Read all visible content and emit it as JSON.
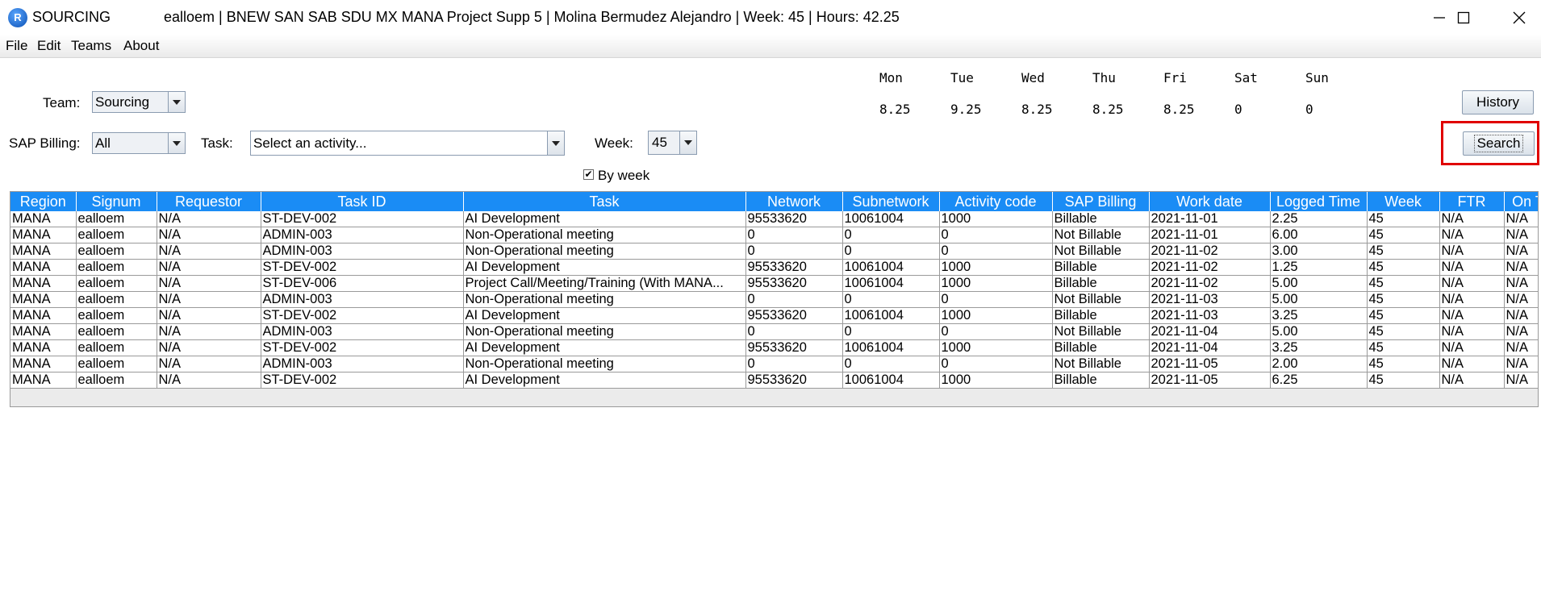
{
  "window": {
    "app_name": "SOURCING",
    "title": "ealloem | BNEW SAN SAB SDU MX MANA Project Supp 5 | Molina Bermudez Alejandro | Week: 45 | Hours: 42.25"
  },
  "menu": [
    "File",
    "Edit",
    "Teams",
    "About"
  ],
  "form": {
    "team_label": "Team:",
    "team_value": "Sourcing",
    "sap_label": "SAP Billing:",
    "sap_value": "All",
    "task_label": "Task:",
    "task_value": "Select an activity...",
    "week_label": "Week:",
    "week_value": "45",
    "by_week_label": "By week",
    "by_week_checked": true,
    "history_button": "History",
    "search_button": "Search"
  },
  "days": [
    {
      "name": "Mon",
      "hours": "8.25"
    },
    {
      "name": "Tue",
      "hours": "9.25"
    },
    {
      "name": "Wed",
      "hours": "8.25"
    },
    {
      "name": "Thu",
      "hours": "8.25"
    },
    {
      "name": "Fri",
      "hours": "8.25"
    },
    {
      "name": "Sat",
      "hours": "0"
    },
    {
      "name": "Sun",
      "hours": "0"
    }
  ],
  "table": {
    "columns": [
      "Region",
      "Signum",
      "Requestor",
      "Task ID",
      "Task",
      "Network",
      "Subnetwork",
      "Activity code",
      "SAP Billing",
      "Work date",
      "Logged Time",
      "Week",
      "FTR",
      "On T"
    ],
    "rows": [
      [
        "MANA",
        "ealloem",
        "N/A",
        "ST-DEV-002",
        "AI Development",
        "95533620",
        "10061004",
        "1000",
        "Billable",
        "2021-11-01",
        "2.25",
        "45",
        "N/A",
        "N/A"
      ],
      [
        "MANA",
        "ealloem",
        "N/A",
        "ADMIN-003",
        "Non-Operational meeting",
        "0",
        "0",
        "0",
        "Not Billable",
        "2021-11-01",
        "6.00",
        "45",
        "N/A",
        "N/A"
      ],
      [
        "MANA",
        "ealloem",
        "N/A",
        "ADMIN-003",
        "Non-Operational meeting",
        "0",
        "0",
        "0",
        "Not Billable",
        "2021-11-02",
        "3.00",
        "45",
        "N/A",
        "N/A"
      ],
      [
        "MANA",
        "ealloem",
        "N/A",
        "ST-DEV-002",
        "AI Development",
        "95533620",
        "10061004",
        "1000",
        "Billable",
        "2021-11-02",
        "1.25",
        "45",
        "N/A",
        "N/A"
      ],
      [
        "MANA",
        "ealloem",
        "N/A",
        "ST-DEV-006",
        "Project Call/Meeting/Training (With MANA...",
        "95533620",
        "10061004",
        "1000",
        "Billable",
        "2021-11-02",
        "5.00",
        "45",
        "N/A",
        "N/A"
      ],
      [
        "MANA",
        "ealloem",
        "N/A",
        "ADMIN-003",
        "Non-Operational meeting",
        "0",
        "0",
        "0",
        "Not Billable",
        "2021-11-03",
        "5.00",
        "45",
        "N/A",
        "N/A"
      ],
      [
        "MANA",
        "ealloem",
        "N/A",
        "ST-DEV-002",
        "AI Development",
        "95533620",
        "10061004",
        "1000",
        "Billable",
        "2021-11-03",
        "3.25",
        "45",
        "N/A",
        "N/A"
      ],
      [
        "MANA",
        "ealloem",
        "N/A",
        "ADMIN-003",
        "Non-Operational meeting",
        "0",
        "0",
        "0",
        "Not Billable",
        "2021-11-04",
        "5.00",
        "45",
        "N/A",
        "N/A"
      ],
      [
        "MANA",
        "ealloem",
        "N/A",
        "ST-DEV-002",
        "AI Development",
        "95533620",
        "10061004",
        "1000",
        "Billable",
        "2021-11-04",
        "3.25",
        "45",
        "N/A",
        "N/A"
      ],
      [
        "MANA",
        "ealloem",
        "N/A",
        "ADMIN-003",
        "Non-Operational meeting",
        "0",
        "0",
        "0",
        "Not Billable",
        "2021-11-05",
        "2.00",
        "45",
        "N/A",
        "N/A"
      ],
      [
        "MANA",
        "ealloem",
        "N/A",
        "ST-DEV-002",
        "AI Development",
        "95533620",
        "10061004",
        "1000",
        "Billable",
        "2021-11-05",
        "6.25",
        "45",
        "N/A",
        "N/A"
      ]
    ]
  },
  "colors": {
    "header_bg": "#1a8cf5",
    "highlight": "#e00000"
  }
}
